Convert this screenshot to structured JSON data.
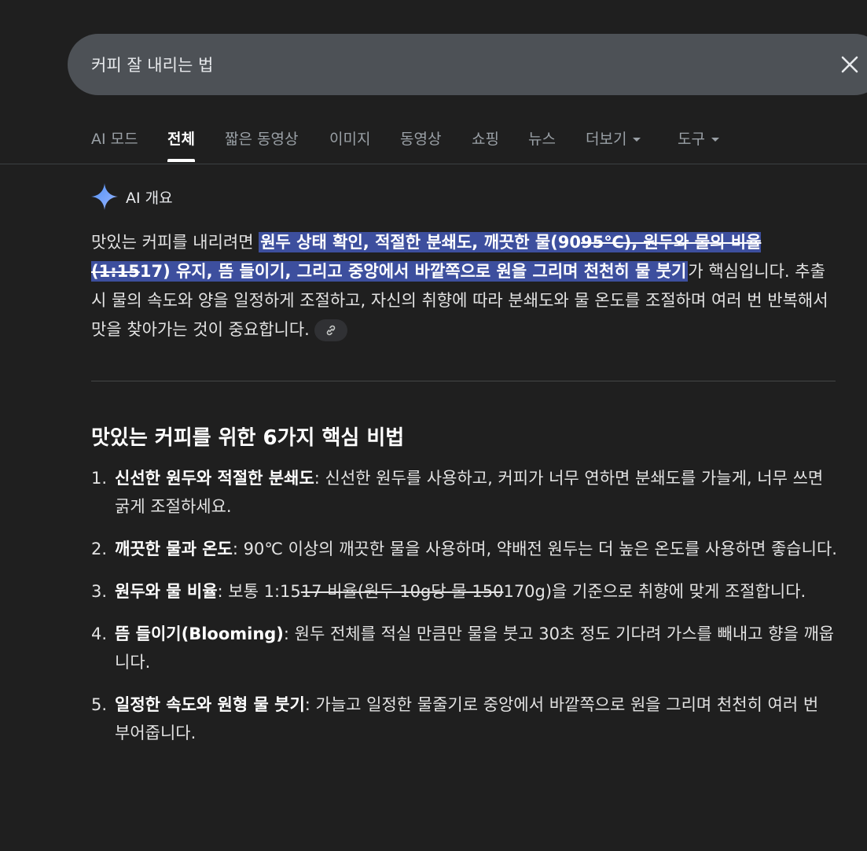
{
  "search": {
    "query": "커피 잘 내리는 법"
  },
  "tabs": [
    {
      "label": "AI 모드"
    },
    {
      "label": "전체"
    },
    {
      "label": "짧은 동영상"
    },
    {
      "label": "이미지"
    },
    {
      "label": "동영상"
    },
    {
      "label": "쇼핑"
    },
    {
      "label": "뉴스"
    },
    {
      "label": "더보기"
    },
    {
      "label": "도구"
    }
  ],
  "ai_overview": {
    "label": "AI 개요",
    "summary": {
      "pre": "맛있는 커피를 내리려면 ",
      "hl_a": "원두 상태 확인, 적절한 분쇄도, 깨끗한 물(90",
      "hl_b": "95℃), 원두와 물의 비율 (1:15",
      "hl_c": "17) 유지, 뜸 들이기, 그리고 중앙에서 바깥쪽으로 원을 그리며 천천히 물 붓기",
      "post": "가 핵심입니다. 추출 시 물의 속도와 양을 일정하게 조절하고, 자신의 취향에 따라 분쇄도와 물 온도를 조절하며 여러 번 반복해서 맛을 찾아가는 것이 중요합니다."
    }
  },
  "section": {
    "title": "맛있는 커피를 위한 6가지 핵심 비법",
    "items": [
      {
        "num": "1.",
        "bold": "신선한 원두와 적절한 분쇄도",
        "text": ": 신선한 원두를 사용하고, 커피가 너무 연하면 분쇄도를 가늘게, 너무 쓰면 굵게 조절하세요."
      },
      {
        "num": "2.",
        "bold": "깨끗한 물과 온도",
        "text": ": 90℃ 이상의 깨끗한 물을 사용하며, 약배전 원두는 더 높은 온도를 사용하면 좋습니다."
      },
      {
        "num": "3.",
        "bold": "원두와 물 비율",
        "pre": ": 보통 1:15",
        "strike": "17 비율(원두 10g당 물 150",
        "post": "170g)을 기준으로 취향에 맞게 조절합니다."
      },
      {
        "num": "4.",
        "bold": "뜸 들이기(Blooming)",
        "text": ": 원두 전체를 적실 만큼만 물을 붓고 30초 정도 기다려 가스를 빼내고 향을 깨웁니다."
      },
      {
        "num": "5.",
        "bold": "일정한 속도와 원형 물 붓기",
        "text": ": 가늘고 일정한 물줄기로 중앙에서 바깥쪽으로 원을 그리며 천천히 여러 번 부어줍니다."
      }
    ]
  }
}
